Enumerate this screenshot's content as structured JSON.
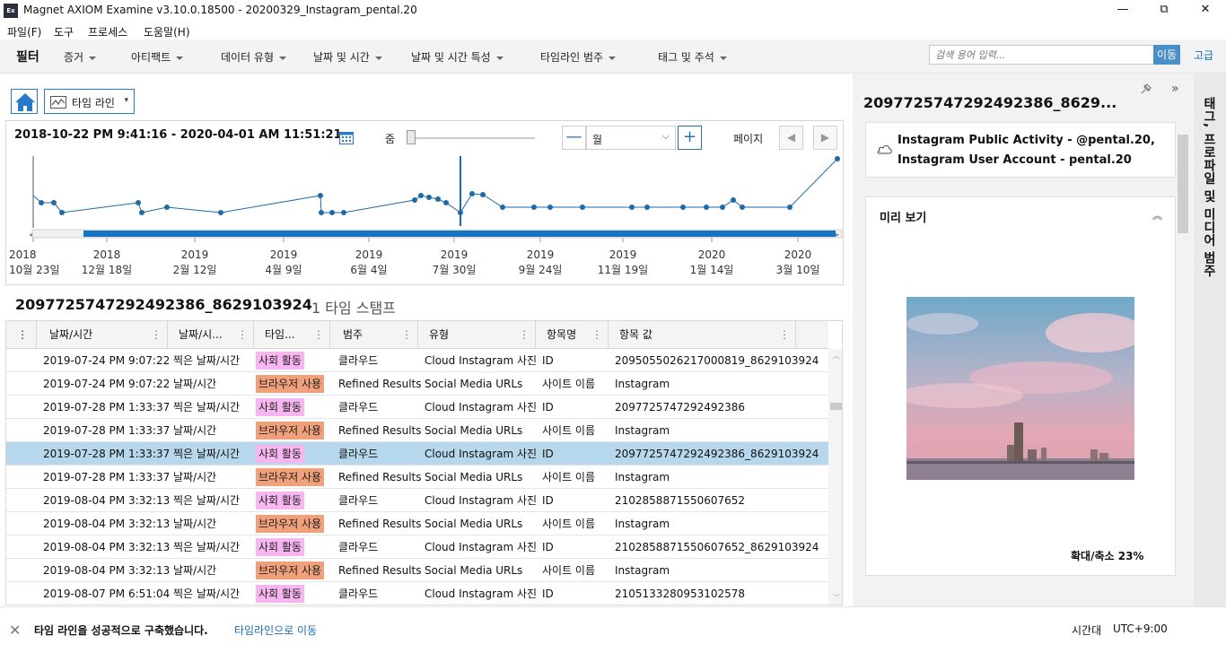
{
  "window": {
    "title": "Magnet AXIOM Examine v3.10.0.18500 - 20200329_Instagram_pental.20",
    "app_icon": "Ex",
    "minimize": "—",
    "restore": "⧉",
    "close": "✕"
  },
  "menu": [
    "파일(F)",
    "도구",
    "프로세스",
    "도움말(H)"
  ],
  "filterbar": {
    "title": "필터",
    "dropdowns": [
      "증거",
      "아티팩트",
      "데이터 유형",
      "날짜 및 시간",
      "날짜 및 시간 특성",
      "타임라인 범주",
      "태그 및 주석"
    ],
    "search_placeholder": "검색 용어 입력...",
    "search_go": "이동",
    "advanced": "고급"
  },
  "toolbar": {
    "view_label": "타임 라인"
  },
  "timeline": {
    "date_range": "2018-10-22 PM 9:41:16  -  2020-04-01 AM 11:51:21",
    "zoom_label": "줌",
    "zoom_minus": "—",
    "zoom_plus": "+",
    "unit": "월",
    "page_label": "페이지",
    "prev": "◀",
    "next": "▶",
    "axis_labels": [
      {
        "year": "2018",
        "date": "10월 23일"
      },
      {
        "year": "2018",
        "date": "12월 18일"
      },
      {
        "year": "2019",
        "date": "2월 12일"
      },
      {
        "year": "2019",
        "date": "4월 9일"
      },
      {
        "year": "2019",
        "date": "6월 4일"
      },
      {
        "year": "2019",
        "date": "7월 30일"
      },
      {
        "year": "2019",
        "date": "9월 24일"
      },
      {
        "year": "2019",
        "date": "11월 19일"
      },
      {
        "year": "2020",
        "date": "1월 14일"
      },
      {
        "year": "2020",
        "date": "3월 10일"
      }
    ]
  },
  "record": {
    "title": "2097725747292492386_8629103924",
    "count": "1 타임 스탬프"
  },
  "table": {
    "headers": [
      "날짜/시간",
      "날짜/시...",
      "타임...",
      "범주",
      "유형",
      "항목명",
      "항목 값"
    ],
    "rows": [
      {
        "dt": "2019-07-24 PM 9:07:22",
        "kind": "찍은 날짜/시간",
        "tag": "사회 활동",
        "tagc": "pink",
        "cat": "클라우드",
        "type": "Cloud Instagram 사진",
        "name": "ID",
        "value": "2095055026217000819_8629103924"
      },
      {
        "dt": "2019-07-24 PM 9:07:22",
        "kind": "날짜/시간",
        "tag": "브라우저 사용",
        "tagc": "orange",
        "cat": "Refined Results",
        "type": "Social Media URLs",
        "name": "사이트 이름",
        "value": "Instagram"
      },
      {
        "dt": "2019-07-28 PM 1:33:37",
        "kind": "찍은 날짜/시간",
        "tag": "사회 활동",
        "tagc": "pink",
        "cat": "클라우드",
        "type": "Cloud Instagram 사진",
        "name": "ID",
        "value": "2097725747292492386"
      },
      {
        "dt": "2019-07-28 PM 1:33:37",
        "kind": "날짜/시간",
        "tag": "브라우저 사용",
        "tagc": "orange",
        "cat": "Refined Results",
        "type": "Social Media URLs",
        "name": "사이트 이름",
        "value": "Instagram"
      },
      {
        "dt": "2019-07-28 PM 1:33:37",
        "kind": "찍은 날짜/시간",
        "tag": "사회 활동",
        "tagc": "pink",
        "cat": "클라우드",
        "type": "Cloud Instagram 사진",
        "name": "ID",
        "value": "2097725747292492386_8629103924",
        "selected": true
      },
      {
        "dt": "2019-07-28 PM 1:33:37",
        "kind": "날짜/시간",
        "tag": "브라우저 사용",
        "tagc": "orange",
        "cat": "Refined Results",
        "type": "Social Media URLs",
        "name": "사이트 이름",
        "value": "Instagram"
      },
      {
        "dt": "2019-08-04 PM 3:32:13",
        "kind": "찍은 날짜/시간",
        "tag": "사회 활동",
        "tagc": "pink",
        "cat": "클라우드",
        "type": "Cloud Instagram 사진",
        "name": "ID",
        "value": "2102858871550607652"
      },
      {
        "dt": "2019-08-04 PM 3:32:13",
        "kind": "날짜/시간",
        "tag": "브라우저 사용",
        "tagc": "orange",
        "cat": "Refined Results",
        "type": "Social Media URLs",
        "name": "사이트 이름",
        "value": "Instagram"
      },
      {
        "dt": "2019-08-04 PM 3:32:13",
        "kind": "찍은 날짜/시간",
        "tag": "사회 활동",
        "tagc": "pink",
        "cat": "클라우드",
        "type": "Cloud Instagram 사진",
        "name": "ID",
        "value": "2102858871550607652_8629103924"
      },
      {
        "dt": "2019-08-04 PM 3:32:13",
        "kind": "날짜/시간",
        "tag": "브라우저 사용",
        "tagc": "orange",
        "cat": "Refined Results",
        "type": "Social Media URLs",
        "name": "사이트 이름",
        "value": "Instagram"
      },
      {
        "dt": "2019-08-07 PM 6:51:04",
        "kind": "찍은 날짜/시간",
        "tag": "사회 활동",
        "tagc": "pink",
        "cat": "클라우드",
        "type": "Cloud Instagram 사진",
        "name": "ID",
        "value": "2105133280953102578"
      }
    ]
  },
  "details": {
    "title": "209772574729249238 6_8629...",
    "title_display": "2097725747292492386_8629...",
    "source": "Instagram Public Activity - @pental.20, Instagram User Account - pental.20",
    "preview_title": "미리 보기",
    "zoom_text": "확대/축소 23%",
    "side_tab": "태그, 프로파일 및 미디어 범주"
  },
  "status": {
    "message": "타임 라인을 성공적으로 구축했습니다.",
    "link": "타임라인으로 이동",
    "tz_label": "시간대",
    "tz_value": "UTC+9:00"
  },
  "colors": {
    "accent": "#2a78c8",
    "tag_social": "#f7b6f0",
    "tag_browser": "#f0a07a",
    "selected_row": "#b7d7ec",
    "timeline_line": "#1e6aa6"
  }
}
